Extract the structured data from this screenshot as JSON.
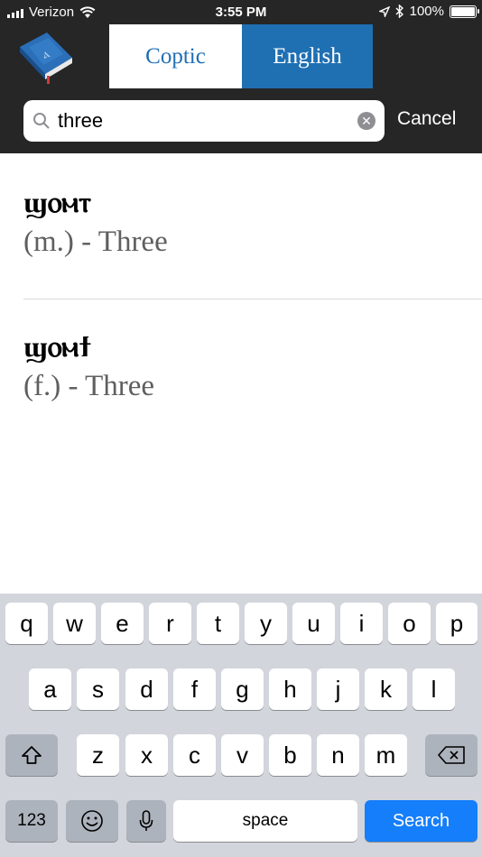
{
  "status_bar": {
    "carrier": "Verizon",
    "time": "3:55 PM",
    "battery": "100%"
  },
  "header": {
    "tabs": [
      {
        "label": "Coptic",
        "selected": false
      },
      {
        "label": "English",
        "selected": true
      }
    ],
    "accent_color": "#1f6fb3"
  },
  "search": {
    "value": "three",
    "placeholder": "",
    "cancel_label": "Cancel"
  },
  "results": [
    {
      "coptic": "ϣⲟⲙⲧ",
      "gloss": "(m.) - Three"
    },
    {
      "coptic": "ϣⲟⲙϯ",
      "gloss": "(f.) - Three"
    }
  ],
  "keyboard": {
    "row1": [
      "q",
      "w",
      "e",
      "r",
      "t",
      "y",
      "u",
      "i",
      "o",
      "p"
    ],
    "row2": [
      "a",
      "s",
      "d",
      "f",
      "g",
      "h",
      "j",
      "k",
      "l"
    ],
    "row3": [
      "z",
      "x",
      "c",
      "v",
      "b",
      "n",
      "m"
    ],
    "numbers_label": "123",
    "space_label": "space",
    "search_label": "Search"
  }
}
